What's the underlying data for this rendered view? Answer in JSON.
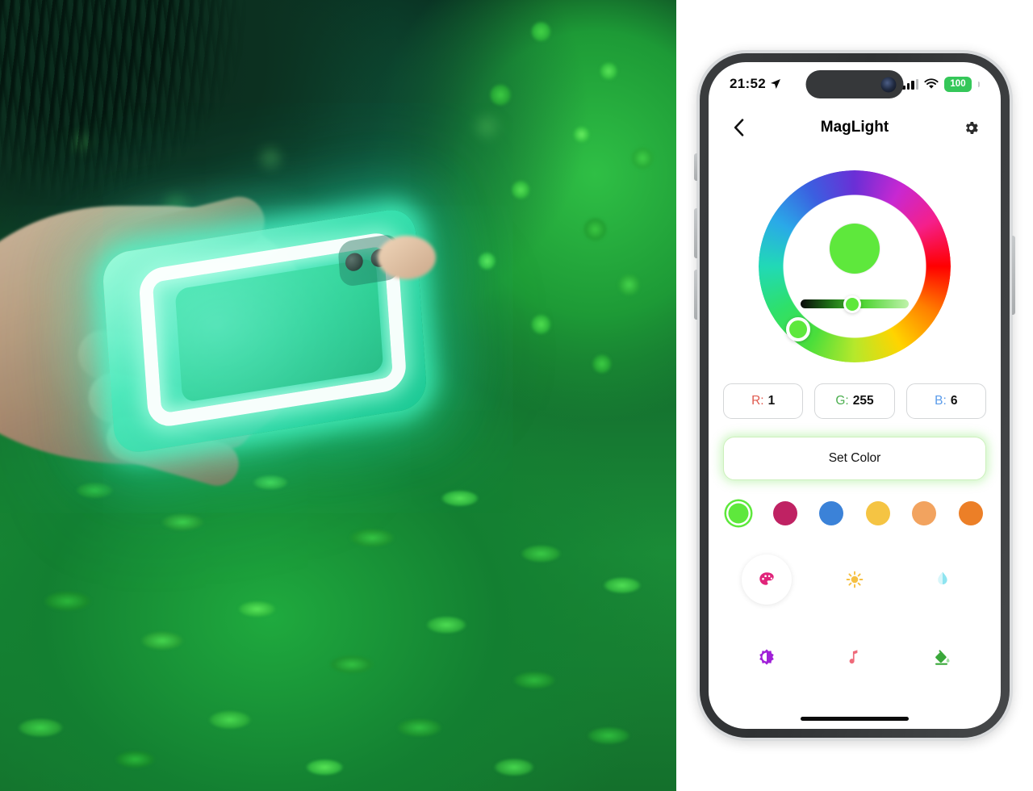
{
  "photo": {
    "caption": "Hand holding a glowing green magnetic light panel in front of green foliage at night",
    "glow_color": "#3ce8b8",
    "foliage_color": "#2fbe3f"
  },
  "phone": {
    "status_bar": {
      "time": "21:52",
      "location_icon": "location-arrow-icon",
      "cellular_icon": "cellular-bars-icon",
      "wifi_icon": "wifi-icon",
      "battery_level": "100",
      "battery_color": "#35c759"
    },
    "nav": {
      "back_icon": "chevron-left-icon",
      "title": "MagLight",
      "settings_icon": "gear-icon"
    },
    "color_wheel": {
      "selected_color": "#5ee83c",
      "handle_icon": "hue-handle",
      "brightness_slider_value": "48",
      "preview_label": "color-preview"
    },
    "rgb": {
      "red": {
        "label": "R:",
        "value": "1",
        "color": "#e05a4e"
      },
      "green": {
        "label": "G:",
        "value": "255",
        "color": "#4caf50"
      },
      "blue": {
        "label": "B:",
        "value": "6",
        "color": "#5a9bea"
      }
    },
    "set_color_button": {
      "label": "Set Color",
      "glow_color": "#6ee650"
    },
    "presets": [
      {
        "name": "preset-green",
        "color": "#5ee83c",
        "selected": true
      },
      {
        "name": "preset-magenta",
        "color": "#bf2263",
        "selected": false
      },
      {
        "name": "preset-blue",
        "color": "#3b82d8",
        "selected": false
      },
      {
        "name": "preset-yellow",
        "color": "#f5c443",
        "selected": false
      },
      {
        "name": "preset-light-orange",
        "color": "#f2a35f",
        "selected": false
      },
      {
        "name": "preset-orange",
        "color": "#ec7f27",
        "selected": false
      }
    ],
    "modes": [
      {
        "name": "palette-icon",
        "color": "#e0247a",
        "active": true
      },
      {
        "name": "sun-icon",
        "color": "#f5c043",
        "active": false
      },
      {
        "name": "water-drop-icon",
        "color": "#8ee4f0",
        "active": false
      },
      {
        "name": "contrast-icon",
        "color": "#a020d8",
        "active": false
      },
      {
        "name": "music-note-icon",
        "color": "#ef6a7a",
        "active": false
      },
      {
        "name": "paint-bucket-icon",
        "color": "#3aa83a",
        "active": false
      }
    ],
    "home_indicator": "home-indicator"
  }
}
